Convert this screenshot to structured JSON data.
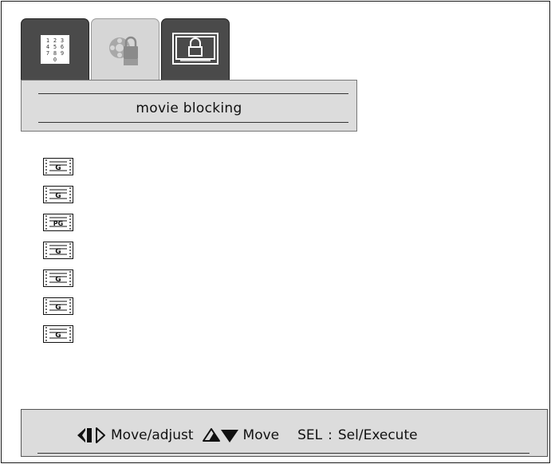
{
  "tabs": [
    {
      "name": "number-pad",
      "numbers": [
        "1",
        "2",
        "3",
        "4",
        "5",
        "6",
        "7",
        "8",
        "9",
        "0"
      ],
      "state": "inactive"
    },
    {
      "name": "movie-blocking",
      "state": "active"
    },
    {
      "name": "tv-blocking",
      "state": "inactive"
    }
  ],
  "panel": {
    "title": "movie blocking"
  },
  "ratings": [
    {
      "label": "G"
    },
    {
      "label": "G"
    },
    {
      "label": "PG"
    },
    {
      "label": "G"
    },
    {
      "label": "G"
    },
    {
      "label": "G"
    },
    {
      "label": "G"
    }
  ],
  "footer": {
    "move_adjust": "Move/adjust",
    "move": "Move",
    "sel_key": "SEL",
    "sel_sep": ":",
    "sel_action": "Sel/Execute"
  },
  "icons": [
    "number-pad-icon",
    "film-reel-lock-icon",
    "tv-lock-icon",
    "rating-badge-icon",
    "left-right-arrows-icon",
    "up-down-arrows-icon"
  ],
  "colors": {
    "tab_dark": "#4a4a4a",
    "tab_active": "#d6d6d6",
    "panel": "#dcdcdc"
  }
}
